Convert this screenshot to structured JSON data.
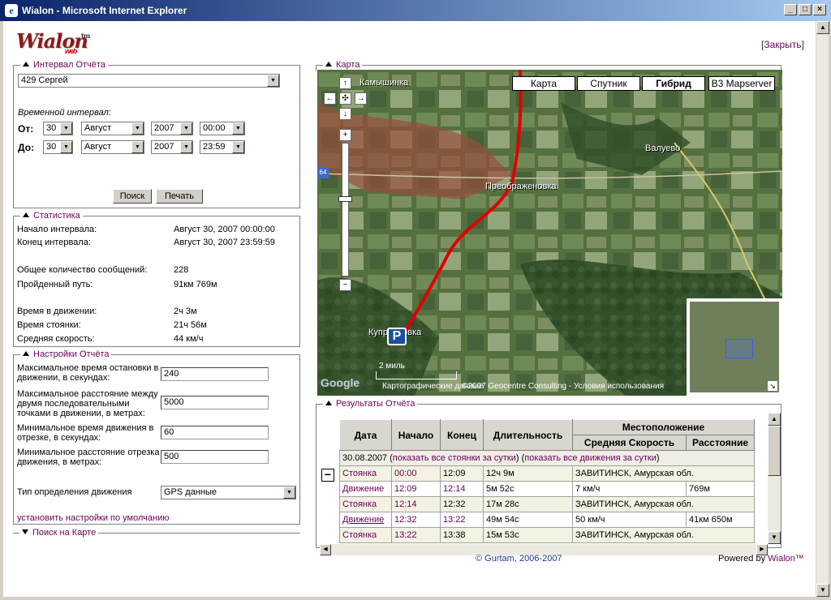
{
  "window": {
    "title": "Wialon - Microsoft Internet Explorer",
    "icon": "ie-icon"
  },
  "header": {
    "logo": "Wialon",
    "logo_tm": "tm",
    "logo_sub": "web",
    "close_link": "Закрыть"
  },
  "report_interval": {
    "legend": "Интервал Отчёта",
    "unit": "429 Сергей",
    "interval_label": "Временной интервал:",
    "from_label": "От:",
    "to_label": "До:",
    "from": {
      "day": "30",
      "month": "Август",
      "year": "2007",
      "time": "00:00"
    },
    "to": {
      "day": "30",
      "month": "Август",
      "year": "2007",
      "time": "23:59"
    },
    "search_button": "Поиск",
    "print_button": "Печать"
  },
  "statistics": {
    "legend": "Статистика",
    "rows": [
      {
        "k": "Начало интервала:",
        "v": "Август 30, 2007 00:00:00"
      },
      {
        "k": "Конец интервала:",
        "v": "Август 30, 2007 23:59:59"
      },
      {
        "k": "Общее количество сообщений:",
        "v": "228"
      },
      {
        "k": "Пройденный путь:",
        "v": "91км 769м"
      },
      {
        "k": "Время в движении:",
        "v": "2ч 3м"
      },
      {
        "k": "Время стоянки:",
        "v": "21ч 56м"
      },
      {
        "k": "Средняя скорость:",
        "v": "44 км/ч"
      }
    ]
  },
  "settings": {
    "legend": "Настройки Отчёта",
    "max_stop_label": "Максимальное время остановки в движении, в секундах:",
    "max_stop_value": "240",
    "max_dist_label": "Максимальное расстояние между двумя последовательными точками в движении, в метрах:",
    "max_dist_value": "5000",
    "min_time_label": "Минимальное время движения в отрезке, в секундах:",
    "min_time_value": "60",
    "min_dist_label": "Минимальное расстояние отрезка движения, в метрах:",
    "min_dist_value": "500",
    "move_type_label": "Тип определения движения",
    "move_type_value": "GPS данные",
    "defaults_link": "установить настройки по умолчанию"
  },
  "map_search": {
    "legend": "Поиск на Карте"
  },
  "map": {
    "legend": "Карта",
    "types": [
      "Карта",
      "Спутник",
      "Гибрид",
      "B3 Mapserver"
    ],
    "active_type": "Гибрид",
    "places": [
      "Камышинка",
      "Валуево",
      "Преображеновка",
      "Куприяновка"
    ],
    "scale": "2 миль",
    "road_label": "64",
    "copyright": "©2007 Geocentre Consulting - Условия использования",
    "copyright_prefix": "Картографические данные",
    "google": "Google",
    "colors": {
      "route": "#e00000",
      "overview_box": "#3b5ee8"
    }
  },
  "results": {
    "legend": "Результаты Отчёта",
    "headers": {
      "date": "Дата",
      "start": "Начало",
      "end": "Конец",
      "duration": "Длительность",
      "location": "Местоположение",
      "avg_speed": "Средняя Скорость",
      "distance": "Расстояние"
    },
    "day": {
      "date": "30.08.2007",
      "show_stops": "показать все стоянки за сутки",
      "show_moves": "показать все движения за сутки"
    },
    "rows": [
      {
        "type": "Стоянка",
        "start": "00:00",
        "end": "12:09",
        "duration": "12ч 9м",
        "info": "ЗАВИТИНСК, Амурская обл.",
        "dist": ""
      },
      {
        "type": "Движение",
        "start": "12:09",
        "end": "12:14",
        "duration": "5м 52с",
        "info": "7 км/ч",
        "dist": "769м"
      },
      {
        "type": "Стоянка",
        "start": "12:14",
        "end": "12:32",
        "duration": "17м 28с",
        "info": "ЗАВИТИНСК, Амурская обл.",
        "dist": ""
      },
      {
        "type": "Движение",
        "start": "12:32",
        "end": "13:22",
        "duration": "49м 54с",
        "info": "50 км/ч",
        "dist": "41км 650м"
      },
      {
        "type": "Стоянка",
        "start": "13:22",
        "end": "13:38",
        "duration": "15м 53с",
        "info": "ЗАВИТИНСК, Амурская обл.",
        "dist": ""
      }
    ]
  },
  "footer": {
    "copyright": "© Gurtam, 2006-2007",
    "powered_prefix": "Powered by",
    "powered_brand": "Wialon™"
  }
}
